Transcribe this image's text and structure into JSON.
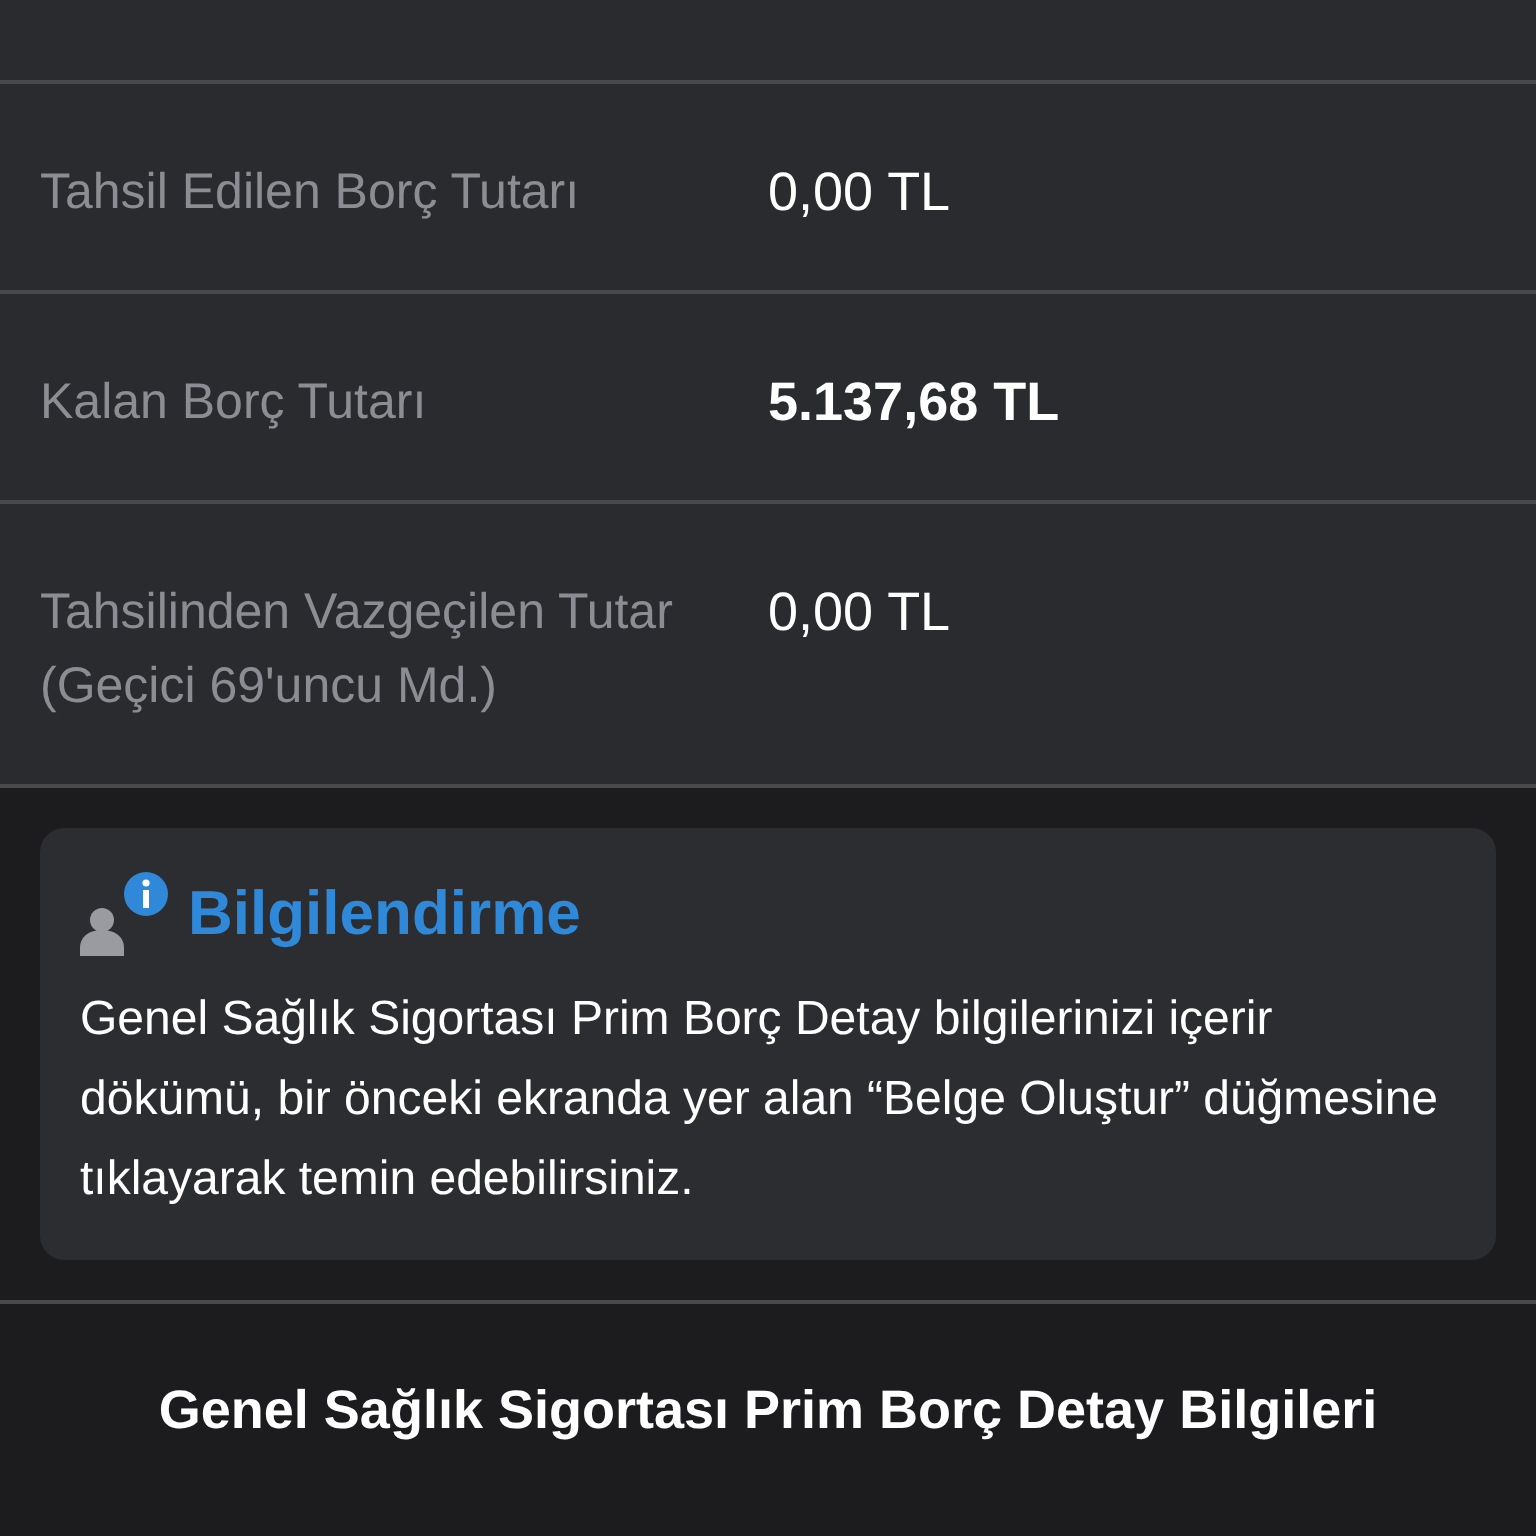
{
  "debt_rows": [
    {
      "label": "Tahsil Edilen Borç Tutarı",
      "value": "0,00 TL",
      "emphasized": false
    },
    {
      "label": "Kalan Borç Tutarı",
      "value": "5.137,68 TL",
      "emphasized": true
    },
    {
      "label": "Tahsilinden Vazgeçilen Tutar (Geçici 69'uncu Md.)",
      "value": "0,00 TL",
      "emphasized": false
    }
  ],
  "info_card": {
    "title": "Bilgilendirme",
    "text": "Genel Sağlık Sigortası Prim Borç Detay bilgilerinizi içerir dökümü, bir önceki ekranda yer alan “Belge Oluştur” düğmesine tıklayarak temin edebilirsiniz."
  },
  "footer": {
    "title": "Genel Sağlık Sigortası Prim Borç Detay Bilgileri"
  }
}
